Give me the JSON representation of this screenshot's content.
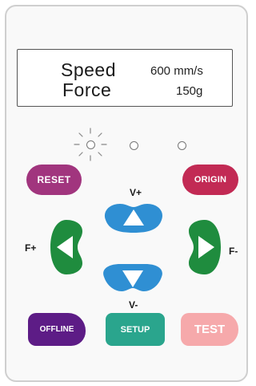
{
  "display": {
    "speed_label": "Speed",
    "speed_value": "600 mm/s",
    "force_label": "Force",
    "force_value": "150g"
  },
  "buttons": {
    "reset": "RESET",
    "origin": "ORIGIN",
    "offline": "OFFLINE",
    "setup": "SETUP",
    "test": "TEST"
  },
  "direction_labels": {
    "v_plus": "V+",
    "v_minus": "V-",
    "f_plus": "F+",
    "f_minus": "F-"
  },
  "colors": {
    "reset": "#a1357e",
    "origin": "#c22a54",
    "arrow_vertical": "#2f8fd3",
    "arrow_horizontal": "#1f8c3e",
    "offline": "#5d1c86",
    "setup": "#2aa58d",
    "test": "#f6a9ab"
  },
  "icons": {
    "up": "triangle-up-icon",
    "down": "triangle-down-icon",
    "left": "triangle-left-icon",
    "right": "triangle-right-icon",
    "power_led": "led-sun-icon"
  }
}
